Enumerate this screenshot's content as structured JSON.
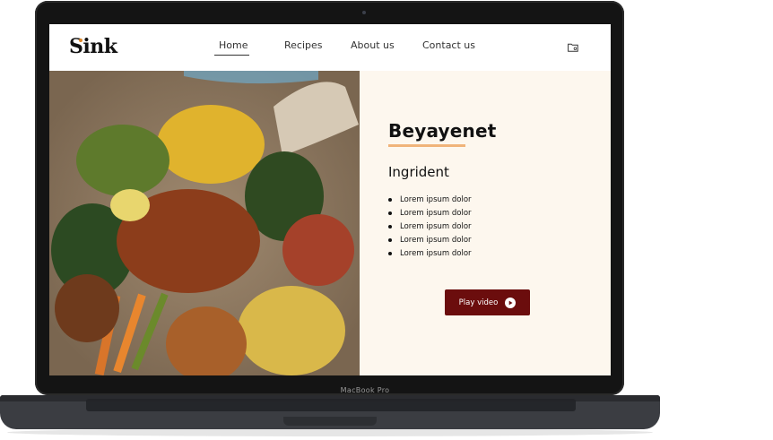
{
  "device": {
    "model_label": "MacBook Pro"
  },
  "site": {
    "logo_text": "Sink",
    "nav": {
      "home": "Home",
      "recipes": "Recipes",
      "about": "About us",
      "contact": "Contact us",
      "active": "Home"
    },
    "header_icons": [
      "folder-icon"
    ]
  },
  "recipe": {
    "title": "Beyayenet",
    "ingredients_heading": "Ingrident",
    "ingredients": [
      "Lorem ipsum dolor",
      "Lorem ipsum dolor",
      "Lorem ipsum dolor",
      "Lorem ipsum dolor",
      "Lorem ipsum dolor"
    ],
    "play_button_label": "Play video"
  },
  "colors": {
    "accent_underline": "#f0b47a",
    "button_bg": "#6b0d0d",
    "panel_bg": "#fdf7ee",
    "logo_dot": "#e08a2c"
  }
}
